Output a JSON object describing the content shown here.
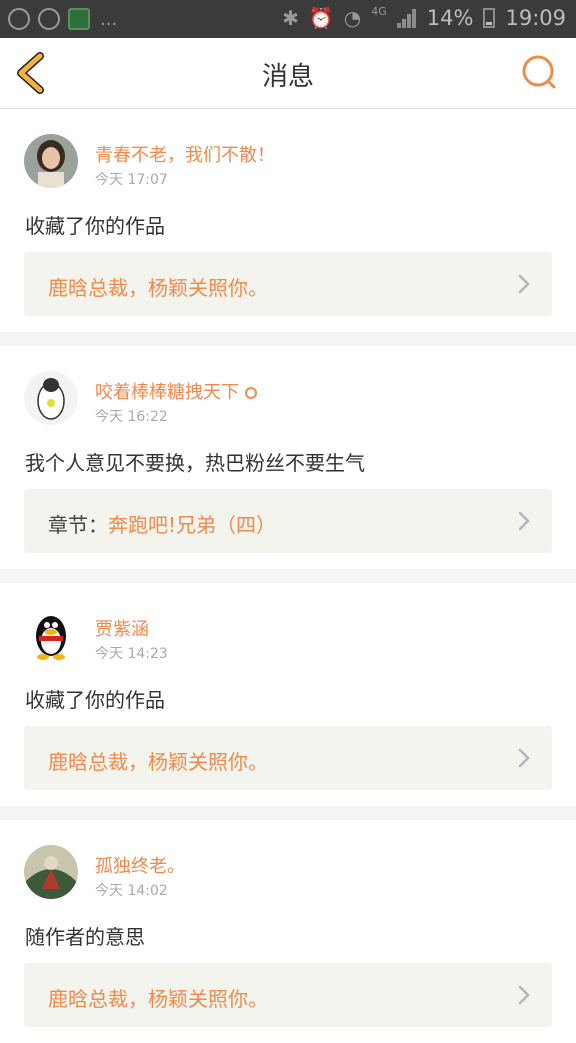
{
  "status_bar": {
    "left_icons": [
      "app-icon",
      "app-icon",
      "app-icon"
    ],
    "overflow": "...",
    "right_icons": [
      "bluetooth-icon",
      "alarm-icon",
      "wifi-icon"
    ],
    "network": "4G",
    "battery": "14%",
    "time": "19:09"
  },
  "header": {
    "title": "消息",
    "back_icon": "chevron-left-icon",
    "search_icon": "search-icon",
    "accent": "#f08a4b",
    "back_color": "#f3b33d"
  },
  "notifications": [
    {
      "user": "青春不老，我们不散！",
      "time": "今天 17:07",
      "message": "收藏了你的作品",
      "link_prefix": "",
      "link_title": "鹿晗总裁，杨颖关照你。",
      "avatar": "girl-photo-avatar"
    },
    {
      "user": "咬着棒棒糖拽天下",
      "time": "今天 16:22",
      "message": "我个人意见不要换，热巴粉丝不要生气",
      "link_prefix": "章节：",
      "link_title": "奔跑吧!兄弟（四）",
      "avatar": "penguin-sketch-avatar"
    },
    {
      "user": "贾紫涵",
      "time": "今天 14:23",
      "message": "收藏了你的作品",
      "link_prefix": "",
      "link_title": "鹿晗总裁，杨颖关照你。",
      "avatar": "qq-penguin-avatar"
    },
    {
      "user": "孤独终老。",
      "time": "今天 14:02",
      "message": "随作者的意思",
      "link_prefix": "",
      "link_title": "鹿晗总裁，杨颖关照你。",
      "avatar": "artwork-avatar"
    }
  ]
}
